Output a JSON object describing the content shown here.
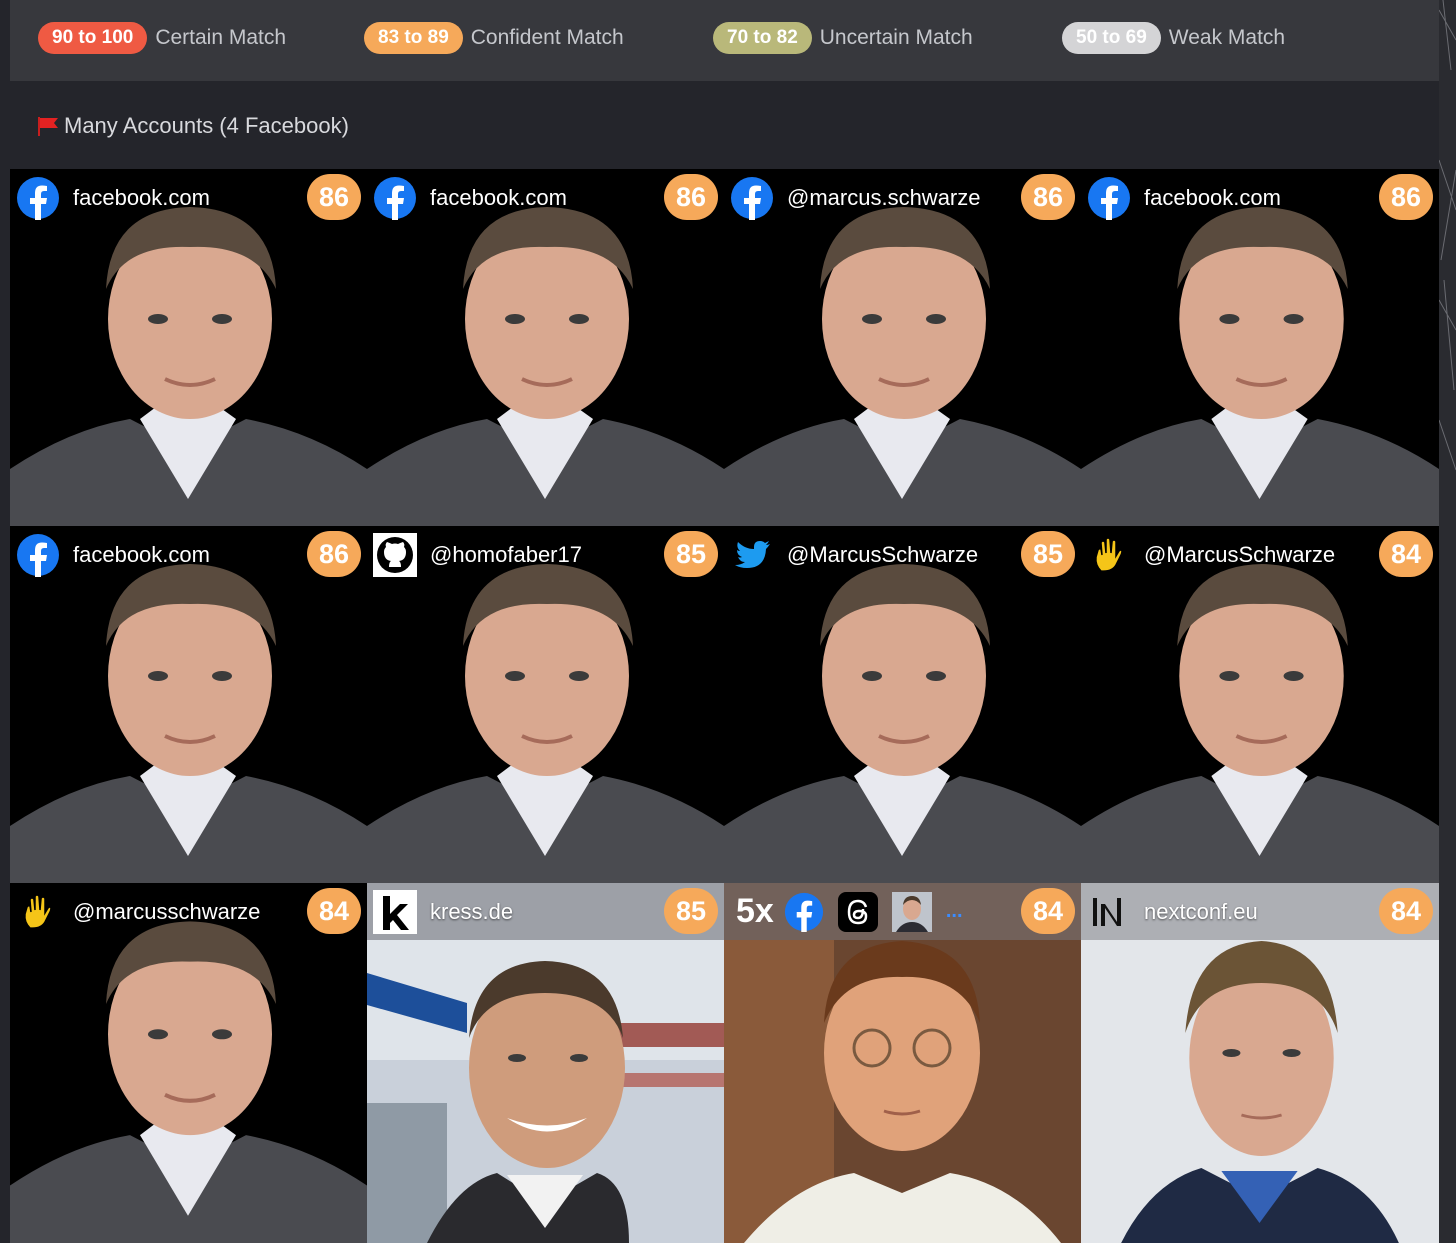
{
  "legend": [
    {
      "range": "90 to 100",
      "label": "Certain Match",
      "color": "#ef5a43"
    },
    {
      "range": "83 to 89",
      "label": "Confident Match",
      "color": "#f6a95a"
    },
    {
      "range": "70 to 82",
      "label": "Uncertain Match",
      "color": "#b9b87a"
    },
    {
      "range": "50 to 69",
      "label": "Weak Match",
      "color": "#d4d4d6"
    }
  ],
  "section": {
    "title": "Many Accounts (4 Facebook)"
  },
  "results": [
    {
      "icon": "facebook-icon",
      "label": "facebook.com",
      "score": "86"
    },
    {
      "icon": "facebook-icon",
      "label": "facebook.com",
      "score": "86"
    },
    {
      "icon": "facebook-icon",
      "label": "@marcus.schwarze",
      "score": "86"
    },
    {
      "icon": "facebook-icon",
      "label": "facebook.com",
      "score": "86"
    },
    {
      "icon": "facebook-icon",
      "label": "facebook.com",
      "score": "86"
    },
    {
      "icon": "github-icon",
      "label": "@homofaber17",
      "score": "85"
    },
    {
      "icon": "twitter-icon",
      "label": "@MarcusSchwarze",
      "score": "85"
    },
    {
      "icon": "waving-hand-icon",
      "label": "@MarcusSchwarze",
      "score": "84"
    },
    {
      "icon": "waving-hand-icon",
      "label": "@marcusschwarze",
      "score": "84"
    },
    {
      "icon": "kress-icon",
      "label": "kress.de",
      "score": "85"
    },
    {
      "icon": "multi-source-icons",
      "label": "5x",
      "extra": "...",
      "score": "84"
    },
    {
      "icon": "nextconf-icon",
      "label": "nextconf.eu",
      "score": "84"
    }
  ]
}
